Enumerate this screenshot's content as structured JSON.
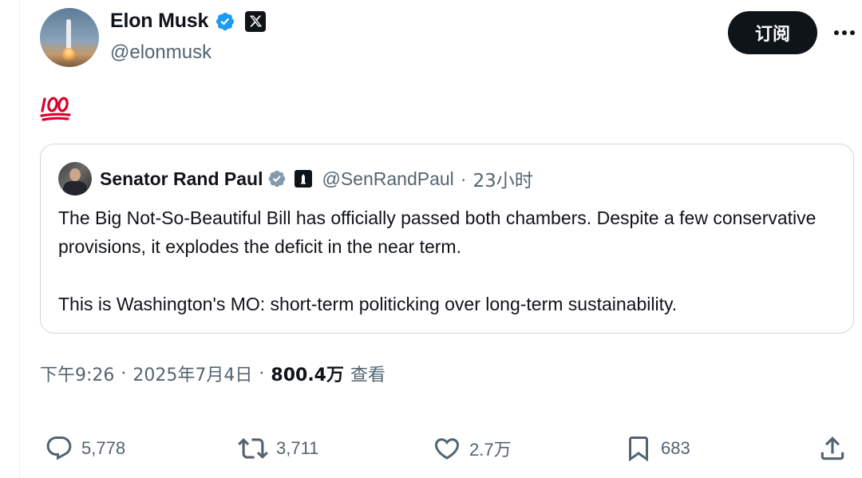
{
  "author": {
    "name": "Elon Musk",
    "handle": "@elonmusk"
  },
  "subscribe_label": "订阅",
  "tweet_text_emoji": "hundred-points-emoji",
  "quoted": {
    "name": "Senator Rand Paul",
    "handle": "@SenRandPaul",
    "separator": "·",
    "time": "23小时",
    "paragraphs": [
      "The Big Not-So-Beautiful Bill has officially passed both chambers. Despite a few conservative provisions, it explodes the deficit in the near term.",
      "This is Washington's MO: short-term politicking over long-term sustainability."
    ]
  },
  "meta": {
    "time": "下午9:26",
    "date": "2025年7月4日",
    "views": "800.4万",
    "views_label": "查看",
    "separator": "·"
  },
  "actions": {
    "replies": "5,778",
    "reposts": "3,711",
    "likes": "2.7万",
    "bookmarks": "683"
  },
  "colors": {
    "text": "#0f1419",
    "secondary": "#536471",
    "verified_blue": "#1d9bf0",
    "border": "#cfd9de",
    "hundred_red": "#d9002d"
  },
  "icons": {
    "verified": "verified-badge-icon",
    "x_logo": "x-logo-icon",
    "more": "more-icon",
    "reply": "reply-icon",
    "repost": "repost-icon",
    "like": "heart-icon",
    "bookmark": "bookmark-icon",
    "share": "share-icon"
  }
}
